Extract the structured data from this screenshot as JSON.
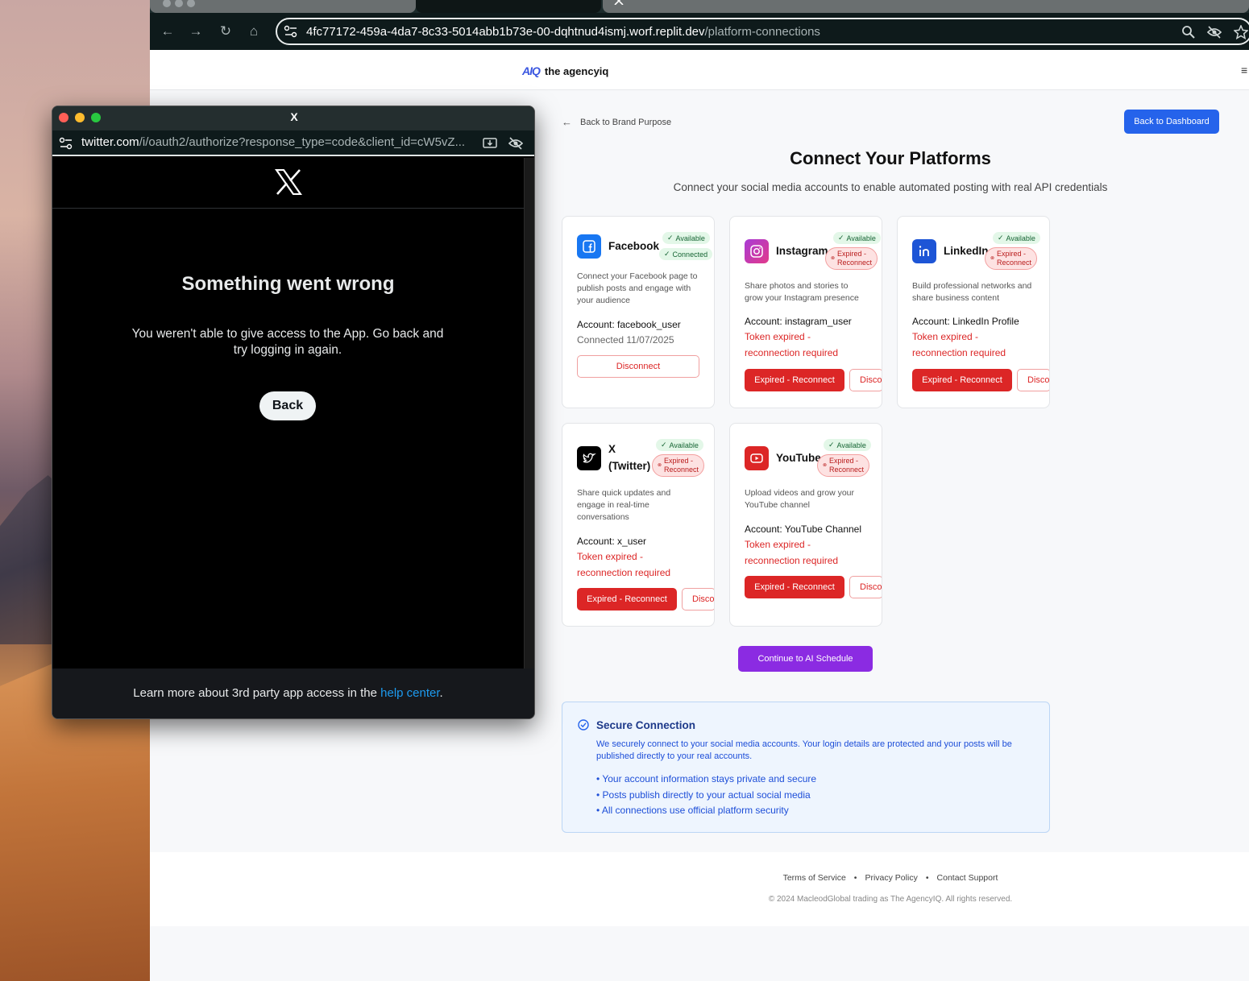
{
  "browser": {
    "url_host": "4fc77172-459a-4da7-8c33-5014abb1b73e-00-dqhtnud4ismj.worf.replit.dev",
    "url_path": "/platform-connections"
  },
  "app": {
    "logo_mark": "AIQ",
    "logo_text": "the agencyiq",
    "back_link": "Back to Brand Purpose",
    "dashboard_button": "Back to Dashboard",
    "title": "Connect Your Platforms",
    "subtitle": "Connect your social media accounts to enable automated posting with real API credentials",
    "continue_button": "Continue to AI Schedule"
  },
  "badges": {
    "available": "Available",
    "connected": "Connected",
    "expired_line1": "Expired -",
    "expired_line2": "Reconnect"
  },
  "platforms": [
    {
      "name": "Facebook",
      "description": "Connect your Facebook page to publish posts and engage with your audience",
      "account": "Account: facebook_user",
      "status": "Connected 11/07/2025",
      "button": "Disconnect"
    },
    {
      "name": "Instagram",
      "description": "Share photos and stories to grow your Instagram presence",
      "account": "Account: instagram_user",
      "status": "Token expired - reconnection required",
      "button": "Expired - Reconnect",
      "button2": "Disco"
    },
    {
      "name": "LinkedIn",
      "description": "Build professional networks and share business content",
      "account": "Account: LinkedIn Profile",
      "status": "Token expired - reconnection required",
      "button": "Expired - Reconnect",
      "button2": "Disco"
    },
    {
      "name": "X (Twitter)",
      "name_line1": "X",
      "name_line2": "(Twitter)",
      "description": "Share quick updates and engage in real-time conversations",
      "account": "Account: x_user",
      "status": "Token expired - reconnection required",
      "button": "Expired - Reconnect",
      "button2": "Disco"
    },
    {
      "name": "YouTube",
      "description": "Upload videos and grow your YouTube channel",
      "account": "Account: YouTube Channel",
      "status": "Token expired - reconnection required",
      "button": "Expired - Reconnect",
      "button2": "Disco"
    }
  ],
  "secure": {
    "title": "Secure Connection",
    "description": "We securely connect to your social media accounts. Your login details are protected and your posts will be published directly to your real accounts.",
    "points": [
      "Your account information stays private and secure",
      "Posts publish directly to your actual social media",
      "All connections use official platform security"
    ]
  },
  "footer": {
    "links": [
      "Terms of Service",
      "Privacy Policy",
      "Contact Support"
    ],
    "separator": "•",
    "copyright": "© 2024 MacleodGlobal trading as The AgencyIQ. All rights reserved."
  },
  "popup": {
    "window_title": "X",
    "url_host": "twitter.com",
    "url_path": "/i/oauth2/authorize?response_type=code&client_id=cW5vZ...",
    "error_title": "Something went wrong",
    "error_message": "You weren't able to give access to the App. Go back and try logging in again.",
    "back_button": "Back",
    "footer_text": "Learn more about 3rd party app access in the ",
    "footer_link": "help center",
    "footer_end": "."
  },
  "colors": {
    "primary_blue": "#2563eb",
    "danger_red": "#dc2626",
    "purple": "#8b2be2",
    "facebook": "#1877f2",
    "linkedin": "#0a66c2",
    "youtube": "#dc2626",
    "x_link": "#1d9bf0"
  }
}
